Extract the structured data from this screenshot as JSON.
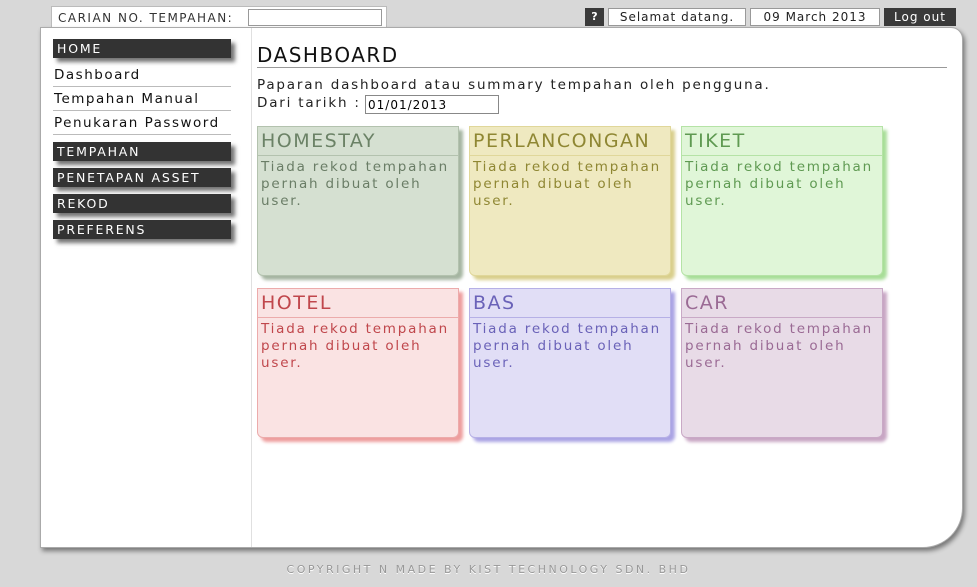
{
  "search": {
    "label": "CARIAN NO. TEMPAHAN:",
    "value": "",
    "placeholder": ""
  },
  "topbar": {
    "help": "?",
    "welcome": "Selamat datang.",
    "date": "09 March 2013",
    "logout": "Log out"
  },
  "sidebar": {
    "home": "HOME",
    "links": [
      "Dashboard",
      "Tempahan Manual",
      "Penukaran Password"
    ],
    "sections": [
      "TEMPAHAN",
      "PENETAPAN ASSET",
      "REKOD",
      "PREFERENS"
    ]
  },
  "main": {
    "title": "DASHBOARD",
    "description": "Paparan dashboard atau summary tempahan oleh pengguna.",
    "date_label": "Dari tarikh :",
    "date_value": "01/01/2013"
  },
  "cards": [
    {
      "title": "HOMESTAY",
      "text": "Tiada rekod tempahan pernah dibuat oleh user.",
      "bg": "#d5e0d1",
      "border": "#b3c2ae",
      "title_color": "#6b8266",
      "text_color": "#6a7d66",
      "shadow": "#a5b5a1"
    },
    {
      "title": "PERLANCONGAN",
      "text": "Tiada rekod tempahan pernah dibuat oleh user.",
      "bg": "#efe9c0",
      "border": "#e0d79a",
      "title_color": "#8f8733",
      "text_color": "#8f8733",
      "shadow": "#d9cf8c"
    },
    {
      "title": "TIKET",
      "text": "Tiada rekod tempahan pernah dibuat oleh user.",
      "bg": "#e0f6d8",
      "border": "#b5e3a6",
      "title_color": "#5f9a52",
      "text_color": "#5f9a52",
      "shadow": "#a8de98"
    },
    {
      "title": "HOTEL",
      "text": "Tiada rekod tempahan pernah dibuat oleh user.",
      "bg": "#fae3e3",
      "border": "#ecabab",
      "title_color": "#c0474c",
      "text_color": "#c0474c",
      "shadow": "#ee9d9d"
    },
    {
      "title": "BAS",
      "text": "Tiada rekod tempahan pernah dibuat oleh user.",
      "bg": "#e1def6",
      "border": "#b6b0e6",
      "title_color": "#6a62b8",
      "text_color": "#6a62b8",
      "shadow": "#aaa3e4"
    },
    {
      "title": "CAR",
      "text": "Tiada rekod tempahan pernah dibuat oleh user.",
      "bg": "#e8dbe7",
      "border": "#c9a9c6",
      "title_color": "#9a6a94",
      "text_color": "#9a6a94",
      "shadow": "#c8a6c4"
    }
  ],
  "footer": "COPYRIGHT N MADE BY KIST TECHNOLOGY SDN. BHD"
}
